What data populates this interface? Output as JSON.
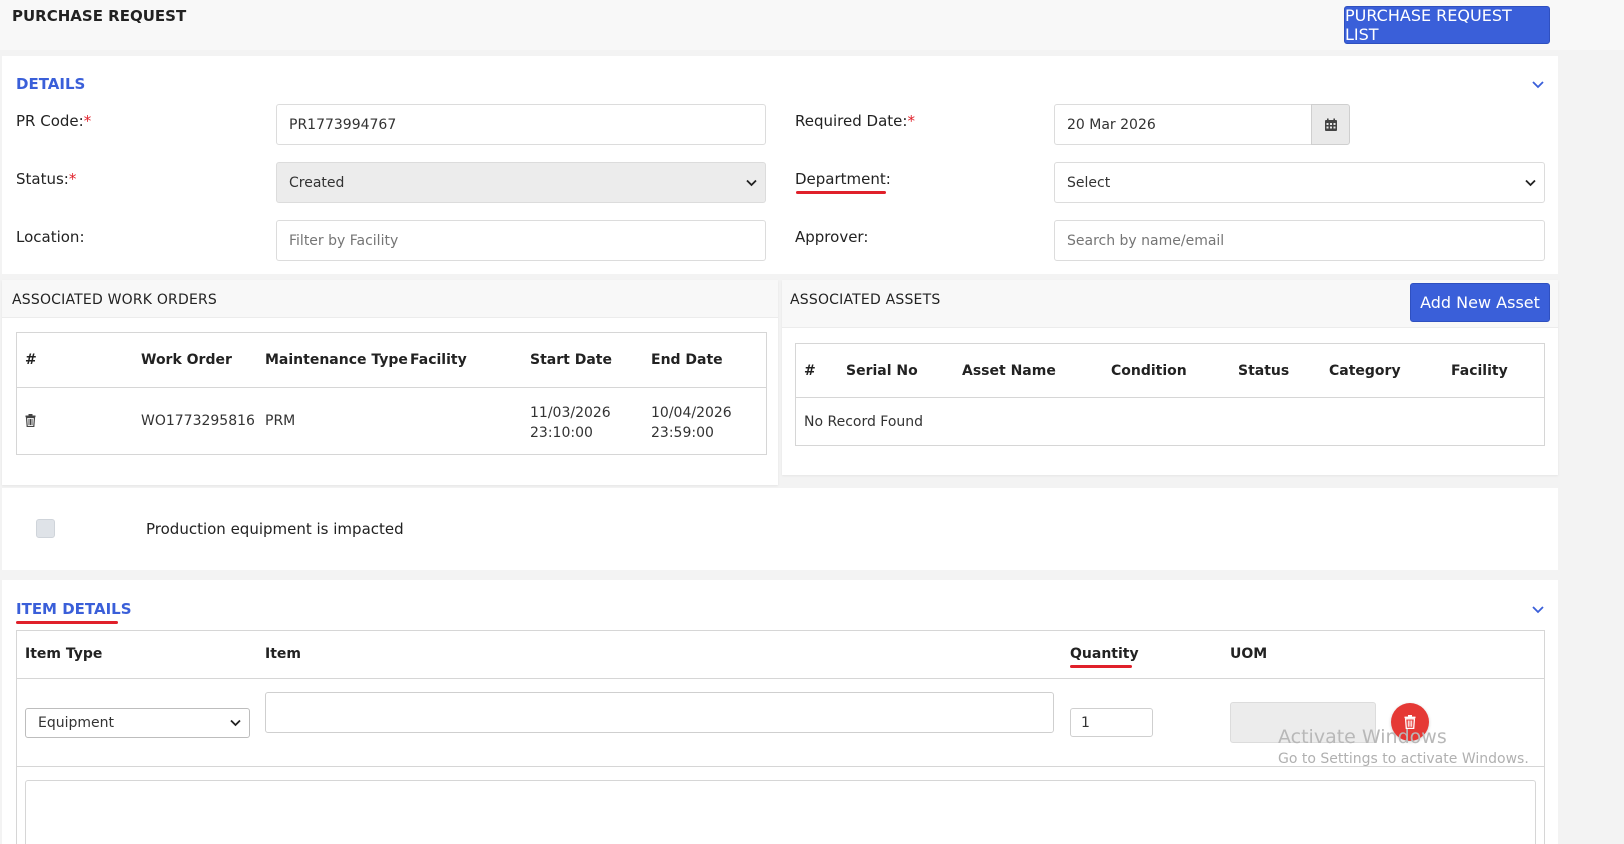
{
  "header": {
    "title": "PURCHASE REQUEST",
    "list_button": "PURCHASE REQUEST LIST"
  },
  "details": {
    "section_title": "DETAILS",
    "pr_code_label": "PR Code:",
    "pr_code_value": "PR1773994767",
    "required_date_label": "Required Date:",
    "required_date_value": "20 Mar 2026",
    "status_label": "Status:",
    "status_value": "Created",
    "department_label": "Department:",
    "department_value": "Select",
    "location_label": "Location:",
    "location_placeholder": "Filter by Facility",
    "approver_label": "Approver:",
    "approver_placeholder": "Search by name/email",
    "required_mark": "*"
  },
  "work_orders": {
    "title": "ASSOCIATED WORK ORDERS",
    "columns": [
      "#",
      "Work Order",
      "Maintenance Type",
      "Facility",
      "Start Date",
      "End Date"
    ],
    "rows": [
      {
        "work_order": "WO1773295816",
        "maintenance_type": "PRM",
        "facility": "",
        "start_date": "11/03/2026",
        "start_time": "23:10:00",
        "end_date": "10/04/2026",
        "end_time": "23:59:00"
      }
    ]
  },
  "assets": {
    "title": "ASSOCIATED ASSETS",
    "add_button": "Add New Asset",
    "columns": [
      "#",
      "Serial No",
      "Asset Name",
      "Condition",
      "Status",
      "Category",
      "Facility"
    ],
    "empty_text": "No Record Found"
  },
  "production": {
    "checkbox_label": "Production equipment is impacted",
    "checked": false
  },
  "item_details": {
    "section_title": "ITEM DETAILS",
    "columns": [
      "Item Type",
      "Item",
      "Quantity",
      "UOM"
    ],
    "row": {
      "item_type": "Equipment",
      "item": "",
      "quantity": "1",
      "uom": ""
    }
  },
  "watermark": {
    "line1": "Activate Windows",
    "line2": "Go to Settings to activate Windows."
  },
  "colors": {
    "accent": "#3a5fd9",
    "required": "#e0202a",
    "delete": "#e53935"
  }
}
